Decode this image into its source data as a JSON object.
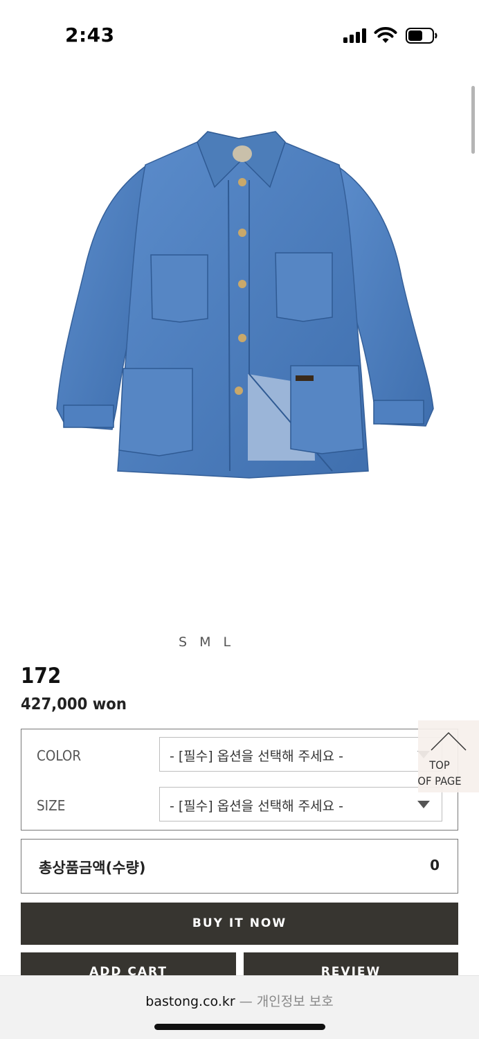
{
  "status_bar": {
    "time": "2:43"
  },
  "product": {
    "image_alt": "denim chore jacket",
    "sizes_note": "S M L",
    "name": "172",
    "price": "427,000 won"
  },
  "options": {
    "color": {
      "label": "COLOR",
      "placeholder": "- [필수] 옵션을 선택해 주세요 -"
    },
    "size": {
      "label": "SIZE",
      "placeholder": "- [필수] 옵션을 선택해 주세요 -"
    }
  },
  "top_button": {
    "line1": "TOP",
    "line2": "OF PAGE"
  },
  "total": {
    "label": "총상품금액(수량)",
    "value": "0"
  },
  "buttons": {
    "buy_now": "BUY IT NOW",
    "add_cart": "ADD CART",
    "review": "REVIEW"
  },
  "browser": {
    "domain": "bastong.co.kr",
    "privacy": "— 개인정보 보호"
  },
  "colors": {
    "button_bg": "#373530",
    "denim": "#4f7fbd"
  }
}
